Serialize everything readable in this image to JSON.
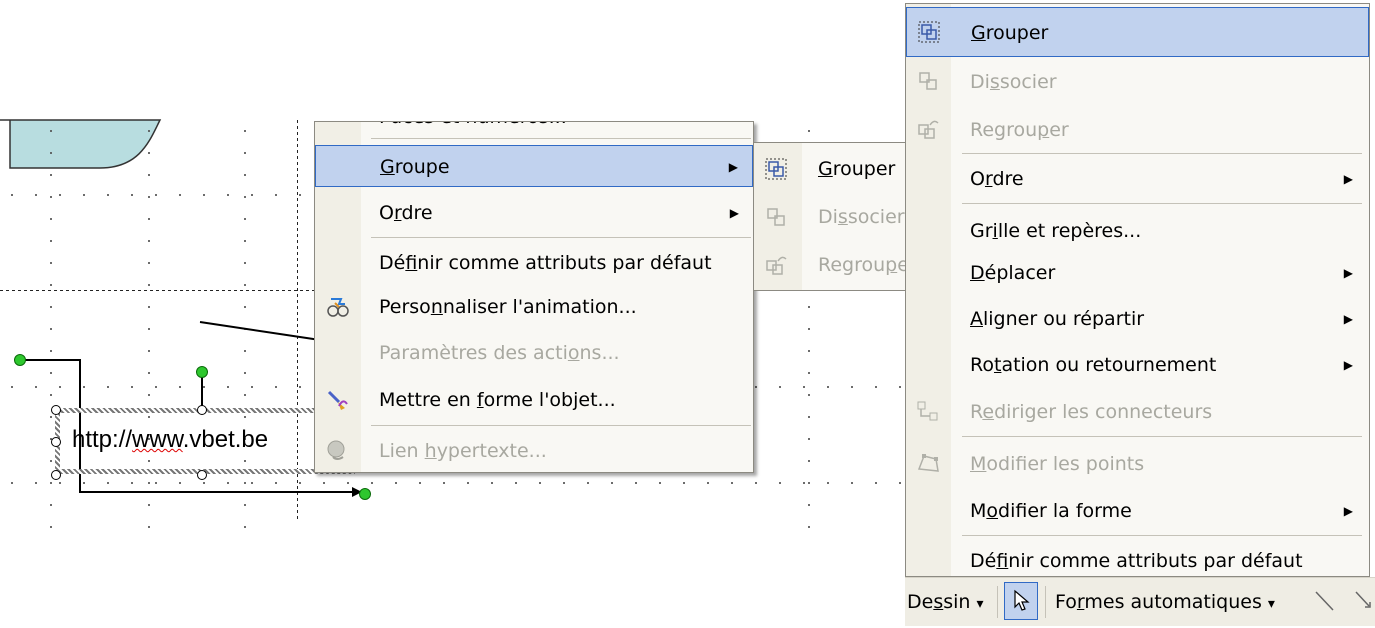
{
  "slide": {
    "textbox_url": "http://www.vbet.be",
    "url_plain": "http://",
    "url_wavy": "www",
    "url_rest": ".vbet.be"
  },
  "context_menu": {
    "items": [
      {
        "label": "Puces et numéros...",
        "disabled": false
      },
      {
        "label": "Groupe",
        "accel": "G",
        "rest": "roupe",
        "submenu": true,
        "highlighted": true
      },
      {
        "label": "Ordre",
        "pre": "O",
        "accel": "r",
        "rest": "dre",
        "submenu": true
      },
      {
        "label": "Définir comme attributs par défaut",
        "pre": "Dé",
        "accel": "f",
        "rest": "inir comme attributs par défaut"
      },
      {
        "label": "Personnaliser l'animation...",
        "pre": "Perso",
        "accel": "n",
        "rest": "naliser l'animation...",
        "icon": "animation-icon"
      },
      {
        "label": "Paramètres des actions...",
        "pre": "Paramètres des acti",
        "accel": "o",
        "rest": "ns...",
        "disabled": true
      },
      {
        "label": "Mettre en forme l'objet...",
        "pre": "Mettre en ",
        "accel": "f",
        "rest": "orme l'objet...",
        "icon": "format-object-icon"
      },
      {
        "label": "Lien hypertexte...",
        "pre": "Lien ",
        "accel": "h",
        "rest": "ypertexte...",
        "disabled": true,
        "icon": "hyperlink-icon"
      }
    ]
  },
  "sub_menu": {
    "items": [
      {
        "label": "Grouper",
        "accel": "G",
        "rest": "rouper"
      },
      {
        "label": "Dissocier",
        "pre": "Di",
        "accel": "s",
        "rest": "socier",
        "disabled": true
      },
      {
        "label": "Regroupe",
        "pre": "Regrou",
        "accel": "p",
        "rest": "e",
        "disabled": true
      }
    ]
  },
  "dessin_menu": {
    "items": [
      {
        "label": "Grouper",
        "accel": "G",
        "rest": "rouper",
        "highlighted": true
      },
      {
        "label": "Dissocier",
        "pre": "Di",
        "accel": "s",
        "rest": "socier",
        "disabled": true
      },
      {
        "label": "Regrouper",
        "pre": "Regrou",
        "accel": "p",
        "rest": "er",
        "disabled": true
      },
      {
        "label": "Ordre",
        "pre": "O",
        "accel": "r",
        "rest": "dre",
        "submenu": true
      },
      {
        "label": "Grille et repères...",
        "pre": "Gr",
        "accel": "i",
        "rest": "lle et repères..."
      },
      {
        "label": "Déplacer",
        "accel": "D",
        "rest": "éplacer",
        "submenu": true
      },
      {
        "label": "Aligner ou répartir",
        "accel": "A",
        "rest": "ligner ou répartir",
        "submenu": true
      },
      {
        "label": "Rotation ou retournement",
        "pre": "Ro",
        "accel": "t",
        "rest": "ation ou retournement",
        "submenu": true
      },
      {
        "label": "Rediriger les connecteurs",
        "pre": "R",
        "accel": "e",
        "rest": "diriger les connecteurs",
        "disabled": true
      },
      {
        "label": "Modifier les points",
        "accel": "M",
        "rest": "odifier les points",
        "disabled": true
      },
      {
        "label": "Modifier la forme",
        "pre": "M",
        "accel": "o",
        "rest": "difier la forme",
        "submenu": true
      },
      {
        "label": "Définir comme attributs par défaut",
        "pre": "Dé",
        "accel": "f",
        "rest": "inir comme attributs par défaut"
      }
    ]
  },
  "toolbar": {
    "dessin_pre": "De",
    "dessin_accel": "s",
    "dessin_rest": "sin",
    "formes_pre": "Fo",
    "formes_accel": "r",
    "formes_rest": "mes automatiques",
    "dropdown_arrow": "▾"
  },
  "icons": {
    "group": "group-icon",
    "ungroup": "ungroup-icon",
    "regroup": "regroup-icon",
    "pointer": "pointer-arrow-icon",
    "line": "line-icon",
    "submenu": "submenu-arrow-icon"
  }
}
